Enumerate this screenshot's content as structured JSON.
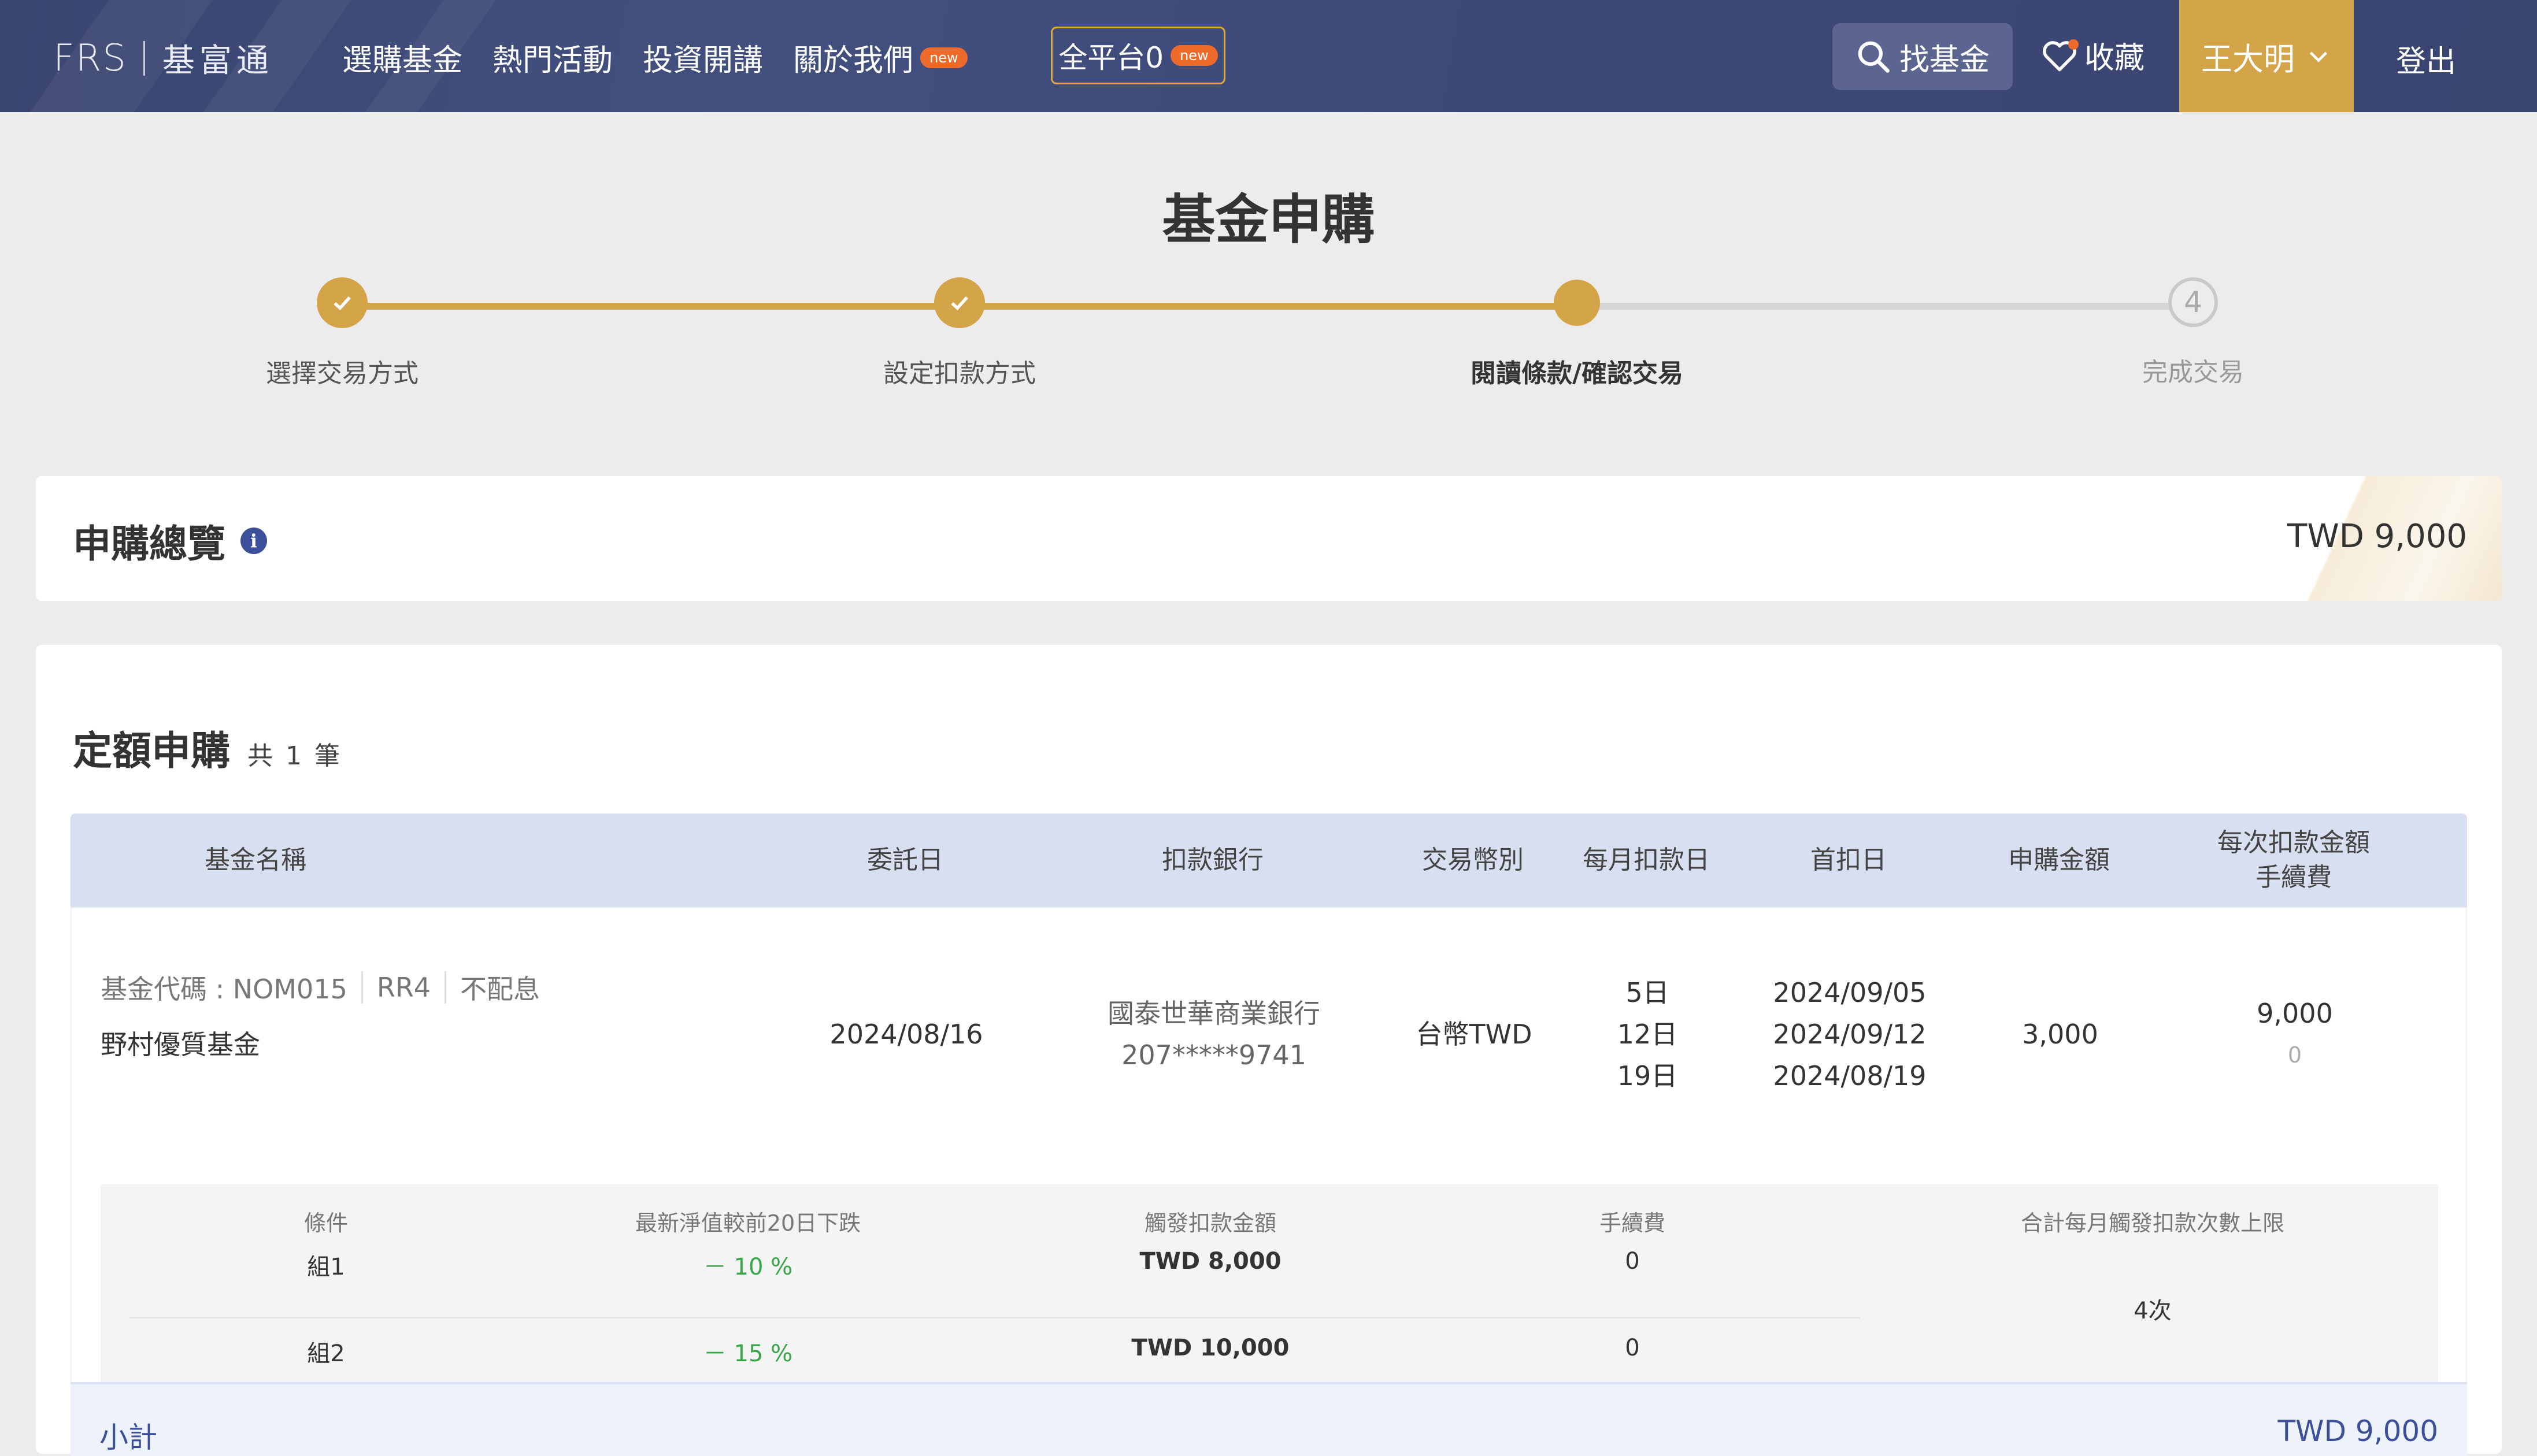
{
  "nav": {
    "logo_mark": "FRS",
    "logo_name": "基富通",
    "menu": [
      {
        "label": "選購基金",
        "badge": ""
      },
      {
        "label": "熱門活動",
        "badge": ""
      },
      {
        "label": "投資開講",
        "badge": ""
      },
      {
        "label": "關於我們",
        "badge": "new"
      }
    ],
    "platform_label": "全平台0",
    "platform_badge": "new",
    "search_label": "找基金",
    "favorites_label": "收藏",
    "user_name": "王大明",
    "logout_label": "登出",
    "brand_color": "#3a4570",
    "accent_color": "#d4a449"
  },
  "page": {
    "title": "基金申購"
  },
  "stepper": {
    "steps": [
      {
        "label": "選擇交易方式",
        "state": "done"
      },
      {
        "label": "設定扣款方式",
        "state": "done"
      },
      {
        "label": "閱讀條款/確認交易",
        "state": "current"
      },
      {
        "label": "完成交易",
        "state": "todo",
        "number": "4"
      }
    ]
  },
  "summary": {
    "title": "申購總覽",
    "info_icon": "i",
    "total": "TWD 9,000"
  },
  "section": {
    "title": "定額申購",
    "count": "共 1 筆"
  },
  "table": {
    "headers": {
      "fund_name": "基金名稱",
      "entrust_date": "委託日",
      "bank": "扣款銀行",
      "currency": "交易幣別",
      "monthly_day": "每月扣款日",
      "first_date": "首扣日",
      "amount": "申購金額",
      "per_deduct_line1": "每次扣款金額",
      "per_deduct_line2": "手續費"
    },
    "row": {
      "fund_code": "基金代碼 : NOM015",
      "risk": "RR4",
      "dividend": "不配息",
      "fund_name": "野村優質基金",
      "entrust_date": "2024/08/16",
      "bank_name": "國泰世華商業銀行",
      "bank_account": "207*****9741",
      "currency": "台幣TWD",
      "days": [
        "5日",
        "12日",
        "19日"
      ],
      "first_dates": [
        "2024/09/05",
        "2024/09/12",
        "2024/08/19"
      ],
      "amount": "3,000",
      "per_deduct": "9,000",
      "fee": "0"
    },
    "conditions": {
      "headers": {
        "condition": "條件",
        "drop": "最新淨值較前20日下跌",
        "trigger": "觸發扣款金額",
        "fee": "手續費",
        "limit": "合計每月觸發扣款次數上限"
      },
      "rows": [
        {
          "group": "組1",
          "drop": "－ 10 %",
          "trigger": "TWD 8,000",
          "fee": "0"
        },
        {
          "group": "組2",
          "drop": "－ 15 %",
          "trigger": "TWD 10,000",
          "fee": "0"
        }
      ],
      "limit_value": "4次"
    }
  },
  "subtotal": {
    "label": "小計",
    "value": "TWD 9,000"
  }
}
